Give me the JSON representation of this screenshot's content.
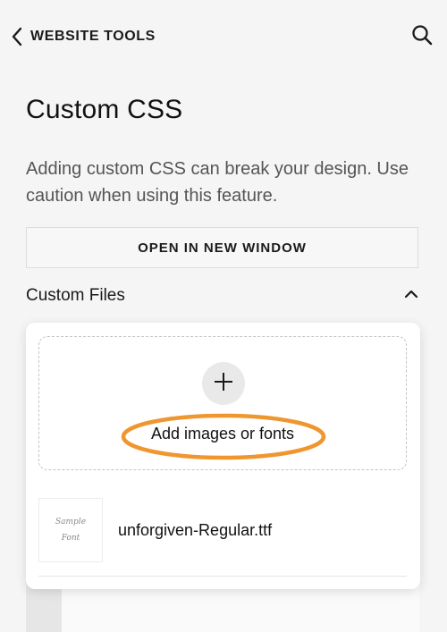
{
  "header": {
    "back_label": "WEBSITE TOOLS",
    "back_icon": "chevron-left-icon",
    "search_icon": "search-icon"
  },
  "page": {
    "title": "Custom CSS",
    "warning": "Adding custom CSS can break your design. Use caution when using this feature.",
    "open_button_label": "OPEN IN NEW WINDOW"
  },
  "custom_files": {
    "section_title": "Custom Files",
    "toggle_icon": "chevron-up-icon",
    "add_icon": "plus-icon",
    "add_label": "Add images or fonts",
    "highlight_color": "#f0962e",
    "files": [
      {
        "name": "unforgiven-Regular.ttf",
        "thumb_line1": "Sample",
        "thumb_line2": "Font"
      }
    ]
  }
}
